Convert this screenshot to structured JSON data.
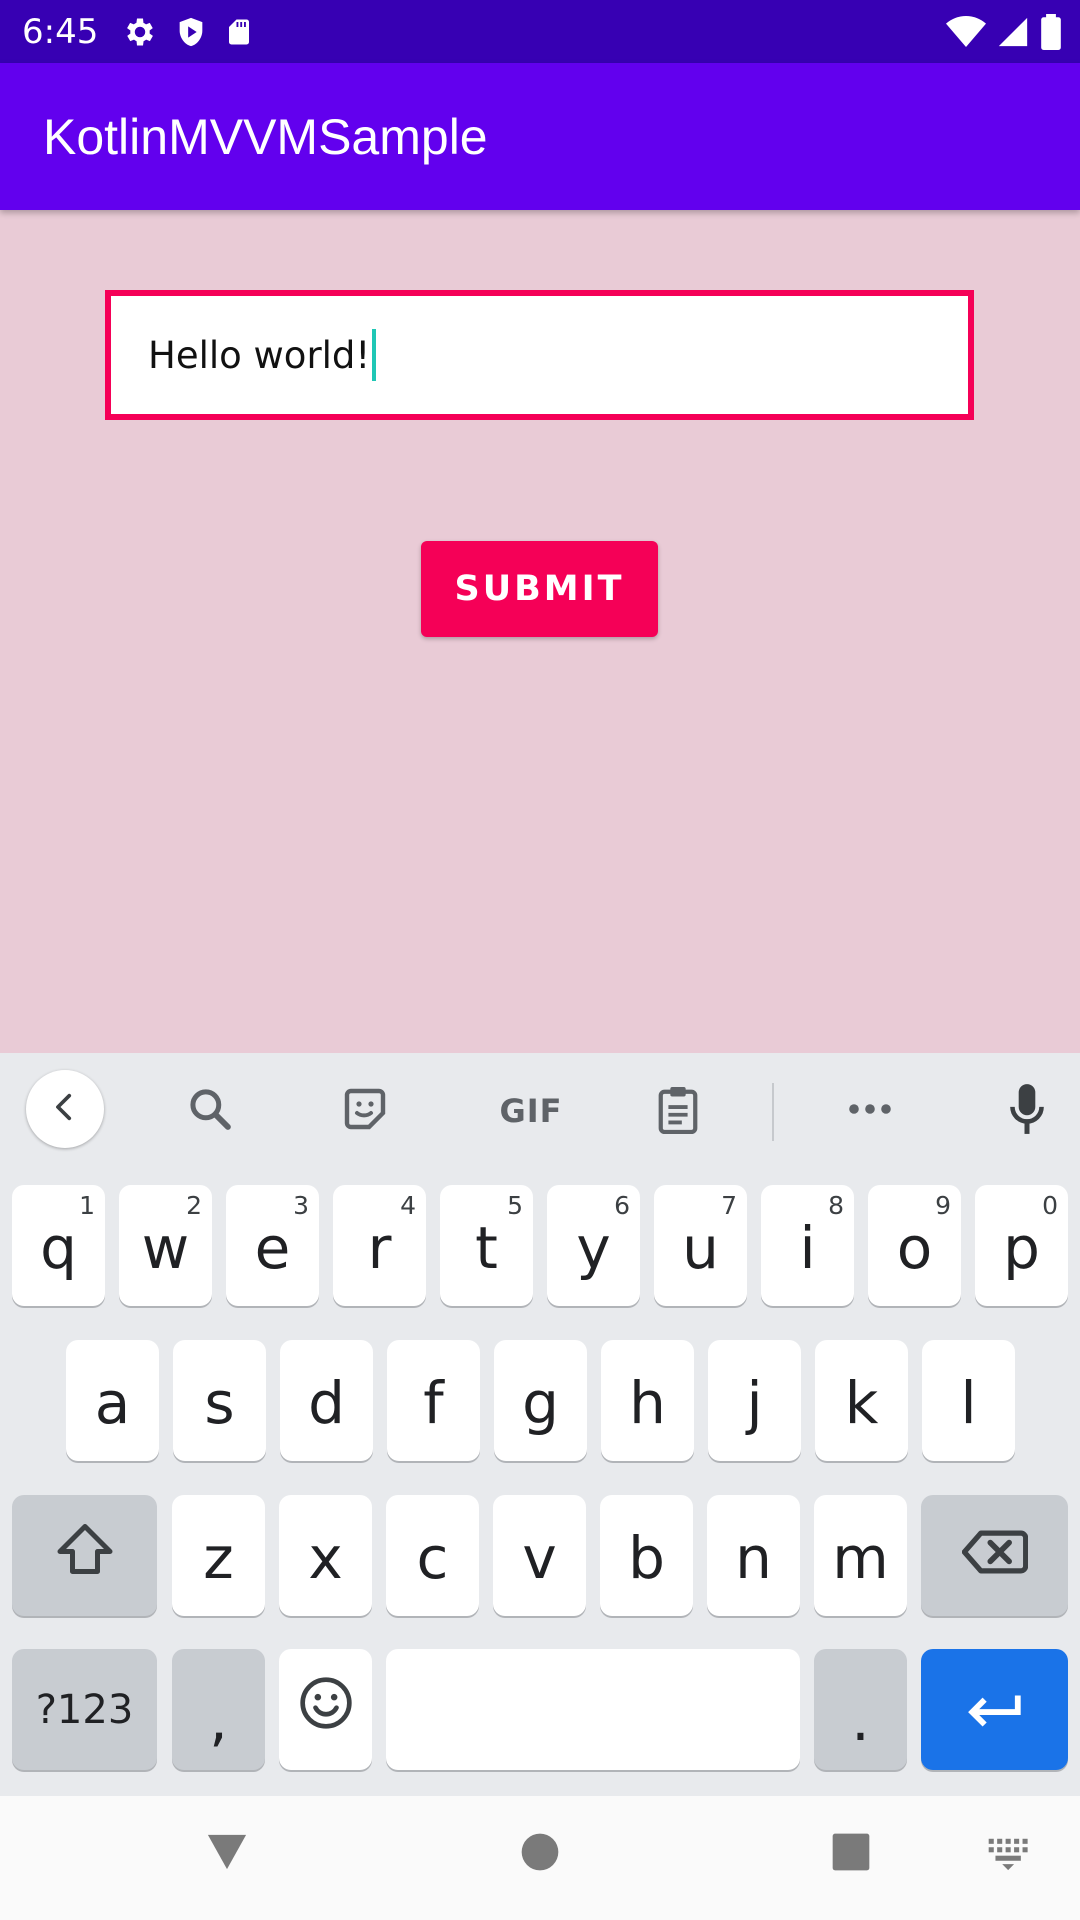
{
  "status_bar": {
    "time": "6:45",
    "icons_left": [
      "settings-icon",
      "shield-icon",
      "sd-card-icon"
    ],
    "icons_right": [
      "wifi-icon",
      "cell-signal-icon",
      "battery-icon"
    ]
  },
  "app_bar": {
    "title": "KotlinMVVMSample"
  },
  "colors": {
    "status_bar": "#3700b3",
    "app_bar": "#6200ee",
    "accent": "#f50057",
    "background": "#e9cbd6",
    "enter_key": "#1a73e8"
  },
  "form": {
    "input_value": "Hello world!",
    "submit_label": "SUBMIT"
  },
  "keyboard": {
    "toolbar": [
      "chevron-left-icon",
      "search-icon",
      "sticker-icon",
      "gif-icon",
      "clipboard-icon",
      "more-icon",
      "mic-icon"
    ],
    "gif_label": "GIF",
    "row1": [
      {
        "key": "q",
        "hint": "1"
      },
      {
        "key": "w",
        "hint": "2"
      },
      {
        "key": "e",
        "hint": "3"
      },
      {
        "key": "r",
        "hint": "4"
      },
      {
        "key": "t",
        "hint": "5"
      },
      {
        "key": "y",
        "hint": "6"
      },
      {
        "key": "u",
        "hint": "7"
      },
      {
        "key": "i",
        "hint": "8"
      },
      {
        "key": "o",
        "hint": "9"
      },
      {
        "key": "p",
        "hint": "0"
      }
    ],
    "row2": [
      "a",
      "s",
      "d",
      "f",
      "g",
      "h",
      "j",
      "k",
      "l"
    ],
    "row3": [
      "z",
      "x",
      "c",
      "v",
      "b",
      "n",
      "m"
    ],
    "symbols_label": "?123",
    "comma": ",",
    "period": "."
  },
  "nav_bar": [
    "back-icon",
    "home-icon",
    "recents-icon",
    "keyboard-switch-icon"
  ]
}
